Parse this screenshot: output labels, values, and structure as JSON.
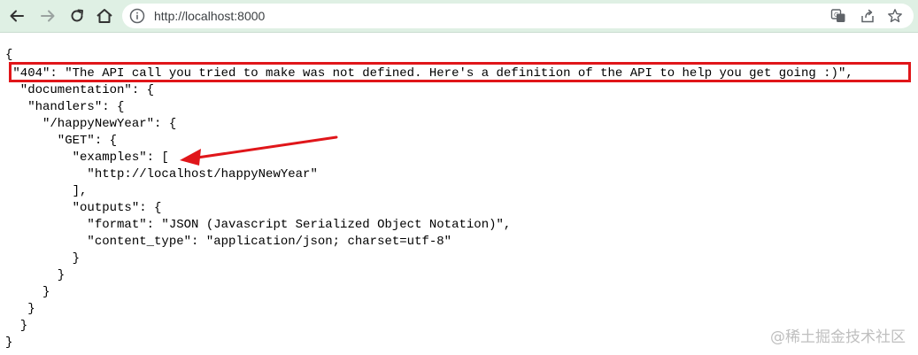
{
  "browser": {
    "url": "http://localhost:8000",
    "icons": {
      "back": "back-arrow-icon",
      "forward": "forward-arrow-icon",
      "reload": "reload-icon",
      "home": "home-icon",
      "info": "info-icon",
      "translate": "translate-icon",
      "share": "share-icon",
      "bookmark": "star-bookmark-icon"
    }
  },
  "json_lines": [
    "{",
    " \"404\": \"The API call you tried to make was not defined. Here's a definition of the API to help you get going :)\",",
    "  \"documentation\": {",
    "   \"handlers\": {",
    "     \"/happyNewYear\": {",
    "       \"GET\": {",
    "         \"examples\": [",
    "           \"http://localhost/happyNewYear\"",
    "         ],",
    "         \"outputs\": {",
    "           \"format\": \"JSON (Javascript Serialized Object Notation)\",",
    "           \"content_type\": \"application/json; charset=utf-8\"",
    "         }",
    "       }",
    "     }",
    "   }",
    "  }",
    "}"
  ],
  "annotations": {
    "highlight_color": "#e0161a",
    "arrow_color": "#e0161a"
  },
  "watermark": "@稀土掘金技术社区",
  "colors": {
    "toolbar_bg": "#dff0e4",
    "text": "#000000"
  }
}
